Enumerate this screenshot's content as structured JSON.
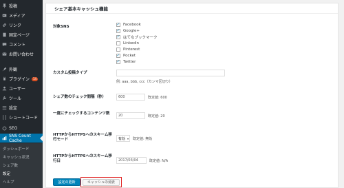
{
  "sidebar": {
    "items": [
      {
        "label": "投稿",
        "icon": "pin-icon"
      },
      {
        "label": "メディア",
        "icon": "media-icon"
      },
      {
        "label": "リンク",
        "icon": "link-icon"
      },
      {
        "label": "固定ページ",
        "icon": "page-icon"
      },
      {
        "label": "コメント",
        "icon": "comment-icon"
      },
      {
        "label": "お問い合わせ",
        "icon": "mail-icon"
      },
      {
        "label": "外観",
        "icon": "brush-icon"
      },
      {
        "label": "プラグイン",
        "icon": "plugin-icon",
        "badge": "14"
      },
      {
        "label": "ユーザー",
        "icon": "user-icon"
      },
      {
        "label": "ツール",
        "icon": "wrench-icon"
      },
      {
        "label": "設定",
        "icon": "settings-icon"
      },
      {
        "label": "ショートコード",
        "icon": "shortcode-icon"
      },
      {
        "label": "SEO",
        "icon": "seo-icon"
      },
      {
        "label": "SNS Count Cache",
        "icon": "chart-icon"
      }
    ],
    "submenu": [
      "ダッシュボード",
      "キャッシュ状況",
      "シェア数",
      "設定",
      "ヘルプ"
    ]
  },
  "panel": {
    "title": "シェア基本キャッシュ機能",
    "sns_label": "対象SNS",
    "sns": [
      {
        "label": "Facebook",
        "checked": true
      },
      {
        "label": "Google+",
        "checked": true
      },
      {
        "label": "はてなブックマーク",
        "checked": true
      },
      {
        "label": "Linkedin",
        "checked": false
      },
      {
        "label": "Pinterest",
        "checked": false
      },
      {
        "label": "Pocket",
        "checked": true
      },
      {
        "label": "Twitter",
        "checked": true
      }
    ],
    "custom_post_label": "カスタム投稿タイプ",
    "custom_post_value": "",
    "custom_post_hint": "例: aaa, bbb, ccc（カンマ区切り）",
    "interval_label": "シェア数のチェック間隔（秒）",
    "interval_value": "600",
    "interval_default": "既定値: 600",
    "contents_label": "一度にチェックするコンテンツ数",
    "contents_value": "20",
    "contents_default": "既定値: 20",
    "migration_mode_label": "HTTPからHTTPSへのスキーム移行モード",
    "migration_mode_value": "有効",
    "migration_mode_default": "既定値: 無効",
    "migration_date_label": "HTTPからHTTPSへのスキーム移行日",
    "migration_date_value": "2017/03/04",
    "migration_date_default": "既定値: N/A",
    "save_button": "設定の更新",
    "clear_button": "キャッシュの消去"
  }
}
